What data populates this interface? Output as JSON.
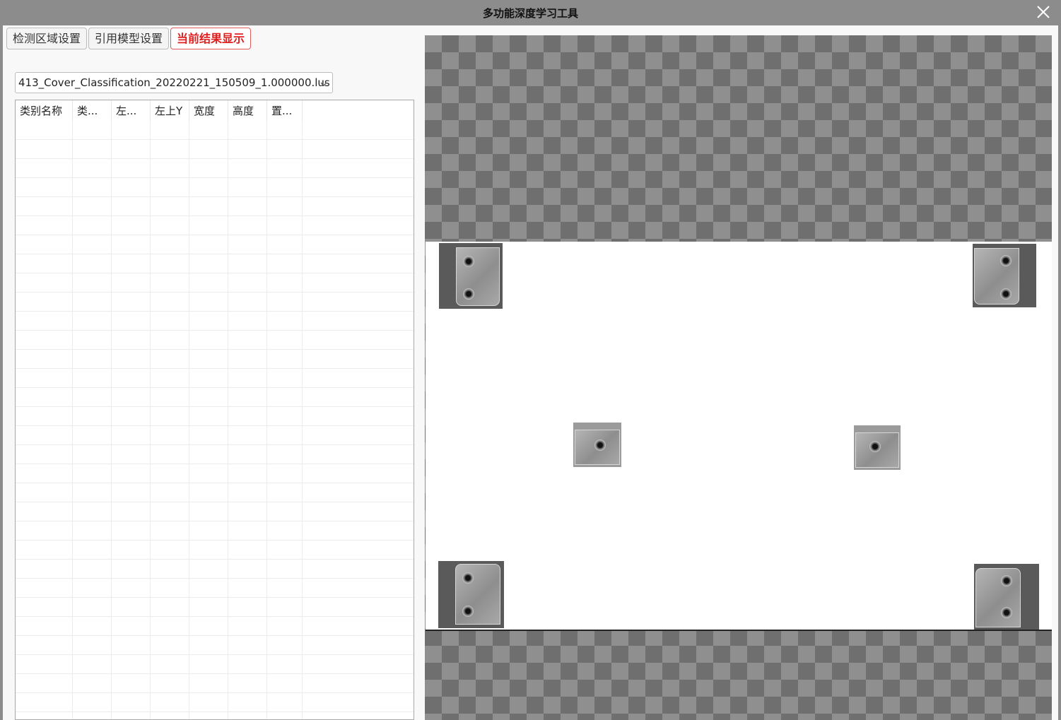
{
  "window": {
    "title": "多功能深度学习工具"
  },
  "tabs": [
    {
      "label": "检测区域设置",
      "active": false
    },
    {
      "label": "引用模型设置",
      "active": false
    },
    {
      "label": "当前结果显示",
      "active": true
    }
  ],
  "model_select": {
    "value": "413_Cover_Classification_20220221_150509_1.000000.lus"
  },
  "result_table": {
    "columns": [
      "类别名称",
      "类...",
      "左...",
      "左上Y",
      "宽度",
      "高度",
      "置..."
    ],
    "rows": []
  },
  "viewer": {
    "background": "transparency-checkerboard",
    "detected_parts": [
      "corner-plate-top-left",
      "corner-plate-top-right",
      "center-plate-left",
      "center-plate-right",
      "corner-plate-bottom-left",
      "corner-plate-bottom-right"
    ]
  },
  "colors": {
    "titlebar": "#8c8c8c",
    "active_tab_text": "#e01f1f",
    "active_tab_border": "#e25a5a"
  },
  "icons": {
    "close": "close-icon",
    "dropdown": "chevron-down-icon"
  }
}
